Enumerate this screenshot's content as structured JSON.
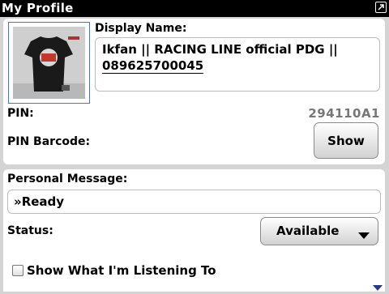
{
  "window": {
    "title": "My Profile",
    "expand_icon": "expand-icon"
  },
  "profile": {
    "avatar_icon": "profile-photo",
    "display_name_label": "Display Name:",
    "display_name_line1": "Ikfan || RACING LINE official PDG ||",
    "display_name_line2": "089625700045",
    "pin_label": "PIN:",
    "pin_value": "294110A1",
    "pin_barcode_label": "PIN Barcode:",
    "show_button_label": "Show"
  },
  "status_section": {
    "personal_message_label": "Personal Message:",
    "personal_message_value": "»Ready",
    "status_label": "Status:",
    "status_value": "Available",
    "listening_checkbox_label": "Show What I'm Listening To",
    "listening_checked": false
  },
  "colors": {
    "accent": "#3a7bd5",
    "pin_text": "#777777",
    "scroll_arrow": "#2a3a8a"
  }
}
